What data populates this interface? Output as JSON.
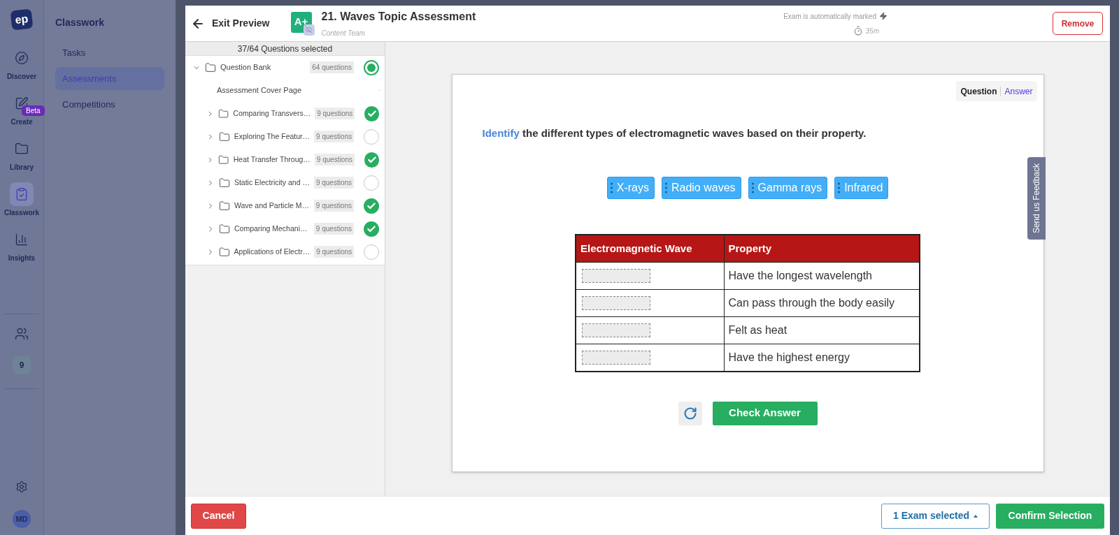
{
  "nav": {
    "logo": "ep",
    "items": [
      {
        "label": "Discover",
        "selected": false
      },
      {
        "label": "Create",
        "selected": false,
        "badge": "Beta"
      },
      {
        "label": "Library",
        "selected": false
      },
      {
        "label": "Classwork",
        "selected": true
      },
      {
        "label": "Insights",
        "selected": false
      }
    ],
    "class_badge": "9",
    "avatar": "MD"
  },
  "sidebar": {
    "title": "Classwork",
    "items": [
      {
        "label": "Tasks",
        "selected": false
      },
      {
        "label": "Assessments",
        "selected": true
      },
      {
        "label": "Competitions",
        "selected": false
      }
    ]
  },
  "header": {
    "back": "Exit Preview",
    "icon_text": "A+",
    "title": "21. Waves Topic Assessment",
    "subtitle": "Content Team",
    "marking": "Exam is automatically marked",
    "duration": "35m",
    "remove": "Remove"
  },
  "tree": {
    "summary": "37/64 Questions selected",
    "root": {
      "label": "Question Bank",
      "count": "64 questions",
      "partial": true,
      "expanded": true,
      "children": [
        {
          "kind": "page",
          "label": "Assessment Cover Page",
          "count": "-"
        },
        {
          "kind": "folder",
          "label": "Comparing Transvers…",
          "count": "9 questions",
          "checked": true,
          "expanded": false
        },
        {
          "kind": "folder",
          "label": "Exploring The Featur…",
          "count": "9 questions",
          "checked": false,
          "expanded": false
        },
        {
          "kind": "folder",
          "label": "Heat Transfer Throug…",
          "count": "9 questions",
          "checked": true,
          "expanded": false
        },
        {
          "kind": "folder",
          "label": "Static Electricity and …",
          "count": "9 questions",
          "checked": false,
          "expanded": false
        },
        {
          "kind": "folder",
          "label": "Wave and Particle M…",
          "count": "9 questions",
          "checked": true,
          "expanded": false
        },
        {
          "kind": "folder",
          "label": "Comparing Mechani…",
          "count": "9 questions",
          "checked": true,
          "expanded": false
        },
        {
          "kind": "folder",
          "label": "Applications of Electr…",
          "count": "9 questions",
          "checked": false,
          "expanded": false
        }
      ]
    }
  },
  "preview": {
    "toggle": [
      {
        "label": "Question",
        "selected": true
      },
      {
        "label": "Answer",
        "selected": false
      }
    ],
    "prompt": "**Identify** the different types of electromagnetic waves based on their property.",
    "chips": [
      "X-rays",
      "Radio waves",
      "Gamma rays",
      "Infrared"
    ],
    "table": {
      "columns": [
        "Electromagnetic Wave",
        "Property"
      ],
      "rows": [
        {
          "property": "Have the longest wavelength"
        },
        {
          "property": "Can pass through the body easily"
        },
        {
          "property": "Felt as heat"
        },
        {
          "property": "Have the highest energy"
        }
      ]
    },
    "check": "Check Answer",
    "feedback": "Send us Feedback"
  },
  "footer": {
    "cancel": "Cancel",
    "selection": "1 Exam selected",
    "confirm": "Confirm Selection"
  }
}
